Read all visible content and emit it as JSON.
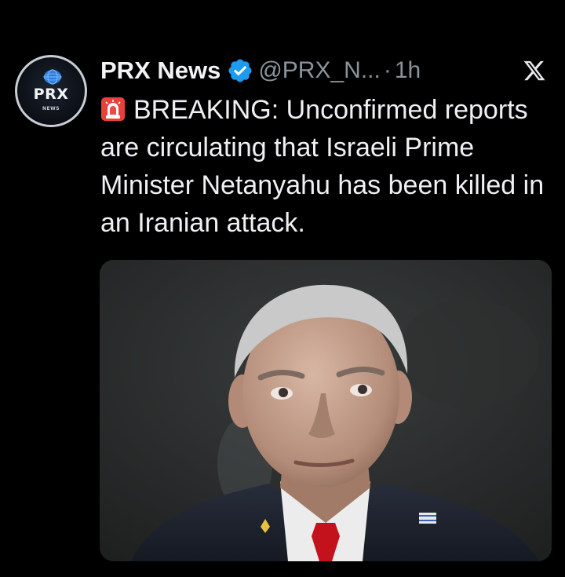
{
  "account": {
    "avatar_text": "PRX",
    "avatar_subtext": "NEWS",
    "display_name": "PRX News",
    "handle": "@PRX_N...",
    "separator": "·",
    "time": "1h",
    "verified_icon": "verified-badge-icon"
  },
  "platform": {
    "logo": "x-logo-icon"
  },
  "tweet": {
    "emoji": "police-siren-icon",
    "text": "BREAKING: Unconfirmed reports are circulating that Israeli Prime Minister Netanyahu has been killed in an Iranian attack."
  },
  "media": {
    "type": "photo"
  },
  "colors": {
    "background": "#000000",
    "text": "#e7e9ea",
    "secondary_text": "#8b949c",
    "verified_blue": "#1d9bf0"
  }
}
